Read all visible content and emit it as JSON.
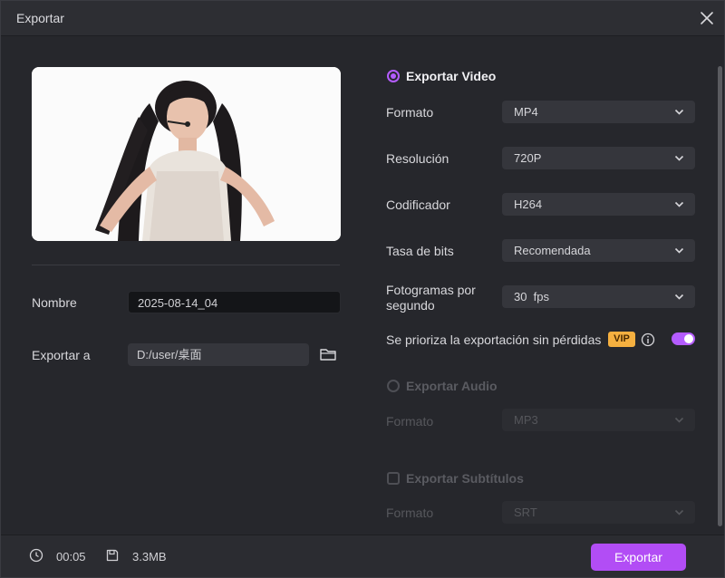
{
  "window": {
    "title": "Exportar"
  },
  "left": {
    "name_label": "Nombre",
    "name_value": "2025-08-14_04",
    "export_to_label": "Exportar a",
    "path_value": "D:/user/桌面"
  },
  "video": {
    "section_label": "Exportar Video",
    "enabled": true,
    "format_label": "Formato",
    "format_value": "MP4",
    "resolution_label": "Resolución",
    "resolution_value": "720P",
    "encoder_label": "Codificador",
    "encoder_value": "H264",
    "bitrate_label": "Tasa de bits",
    "bitrate_value": "Recomendada",
    "fps_label_line1": "Fotogramas por",
    "fps_label_line2": "segundo",
    "fps_value": "30  fps",
    "lossless_label": "Se prioriza la exportación sin pérdidas",
    "vip_badge": "VIP",
    "lossless_on": true
  },
  "audio": {
    "section_label": "Exportar Audio",
    "enabled": false,
    "format_label": "Formato",
    "format_value": "MP3"
  },
  "subtitles": {
    "section_label": "Exportar Subtítulos",
    "enabled": false,
    "format_label": "Formato",
    "format_value": "SRT"
  },
  "footer": {
    "duration": "00:05",
    "size": "3.3MB",
    "export_button": "Exportar"
  },
  "colors": {
    "accent": "#b45cff",
    "button": "#b24df5",
    "vip": "#f5b040",
    "background": "#26272c"
  },
  "icons": [
    "close-icon",
    "folder-icon",
    "chevron-down-icon",
    "info-icon",
    "clock-icon",
    "save-icon"
  ]
}
